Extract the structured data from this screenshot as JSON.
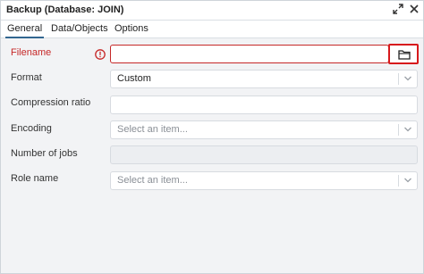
{
  "window": {
    "title": "Backup (Database: JOIN)",
    "controls": {
      "expand_icon": "expand-arrows-icon",
      "close_icon": "close-icon"
    }
  },
  "tabs": [
    {
      "label": "General",
      "active": true
    },
    {
      "label": "Data/Objects",
      "active": false
    },
    {
      "label": "Options",
      "active": false
    }
  ],
  "form": {
    "filename": {
      "label": "Filename",
      "value": "",
      "has_error": true,
      "browse_icon": "folder-icon"
    },
    "format": {
      "label": "Format",
      "value": "Custom"
    },
    "compression_ratio": {
      "label": "Compression ratio",
      "value": ""
    },
    "encoding": {
      "label": "Encoding",
      "placeholder": "Select an item..."
    },
    "number_of_jobs": {
      "label": "Number of jobs",
      "value": ""
    },
    "role_name": {
      "label": "Role name",
      "placeholder": "Select an item..."
    }
  },
  "colors": {
    "error": "#c62828",
    "highlight_box": "#d7191c",
    "active_tab_underline": "#326690"
  }
}
